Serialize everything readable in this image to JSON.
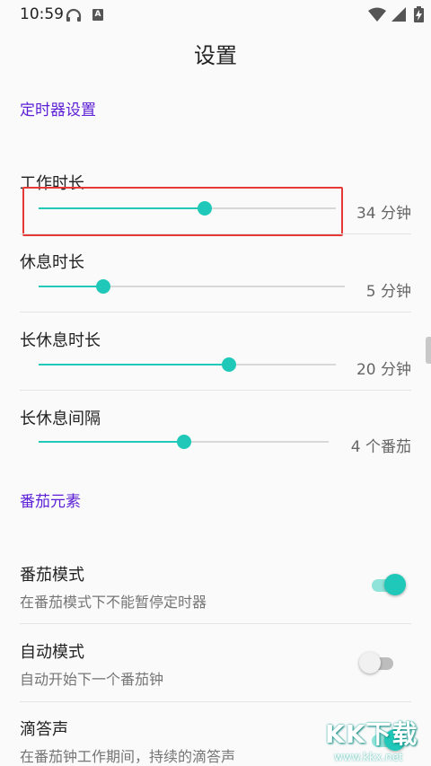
{
  "status_bar": {
    "time": "10:59",
    "a_badge": "A"
  },
  "header": {
    "title": "设置"
  },
  "timer_section": {
    "title": "定时器设置",
    "sliders": [
      {
        "label": "工作时长",
        "value_text": "34 分钟",
        "fraction": 0.56
      },
      {
        "label": "休息时长",
        "value_text": "5 分钟",
        "fraction": 0.21
      },
      {
        "label": "长休息时长",
        "value_text": "20 分钟",
        "fraction": 0.64
      },
      {
        "label": "长休息间隔",
        "value_text": "4 个番茄",
        "fraction": 0.5
      }
    ]
  },
  "tomato_section": {
    "title": "番茄元素",
    "prefs": [
      {
        "title": "番茄模式",
        "summary": "在番茄模式下不能暂停定时器",
        "enabled": true
      },
      {
        "title": "自动模式",
        "summary": "自动开始下一个番茄钟",
        "enabled": false
      },
      {
        "title": "滴答声",
        "summary": "在番茄钟工作期间，持续的滴答声",
        "enabled": true
      }
    ]
  },
  "watermark": {
    "text": "KK下载",
    "url": "www.kkx.net"
  },
  "colors": {
    "accent": "#1fc8b8",
    "section_header": "#5c1fd6",
    "highlight": "#e53935"
  }
}
